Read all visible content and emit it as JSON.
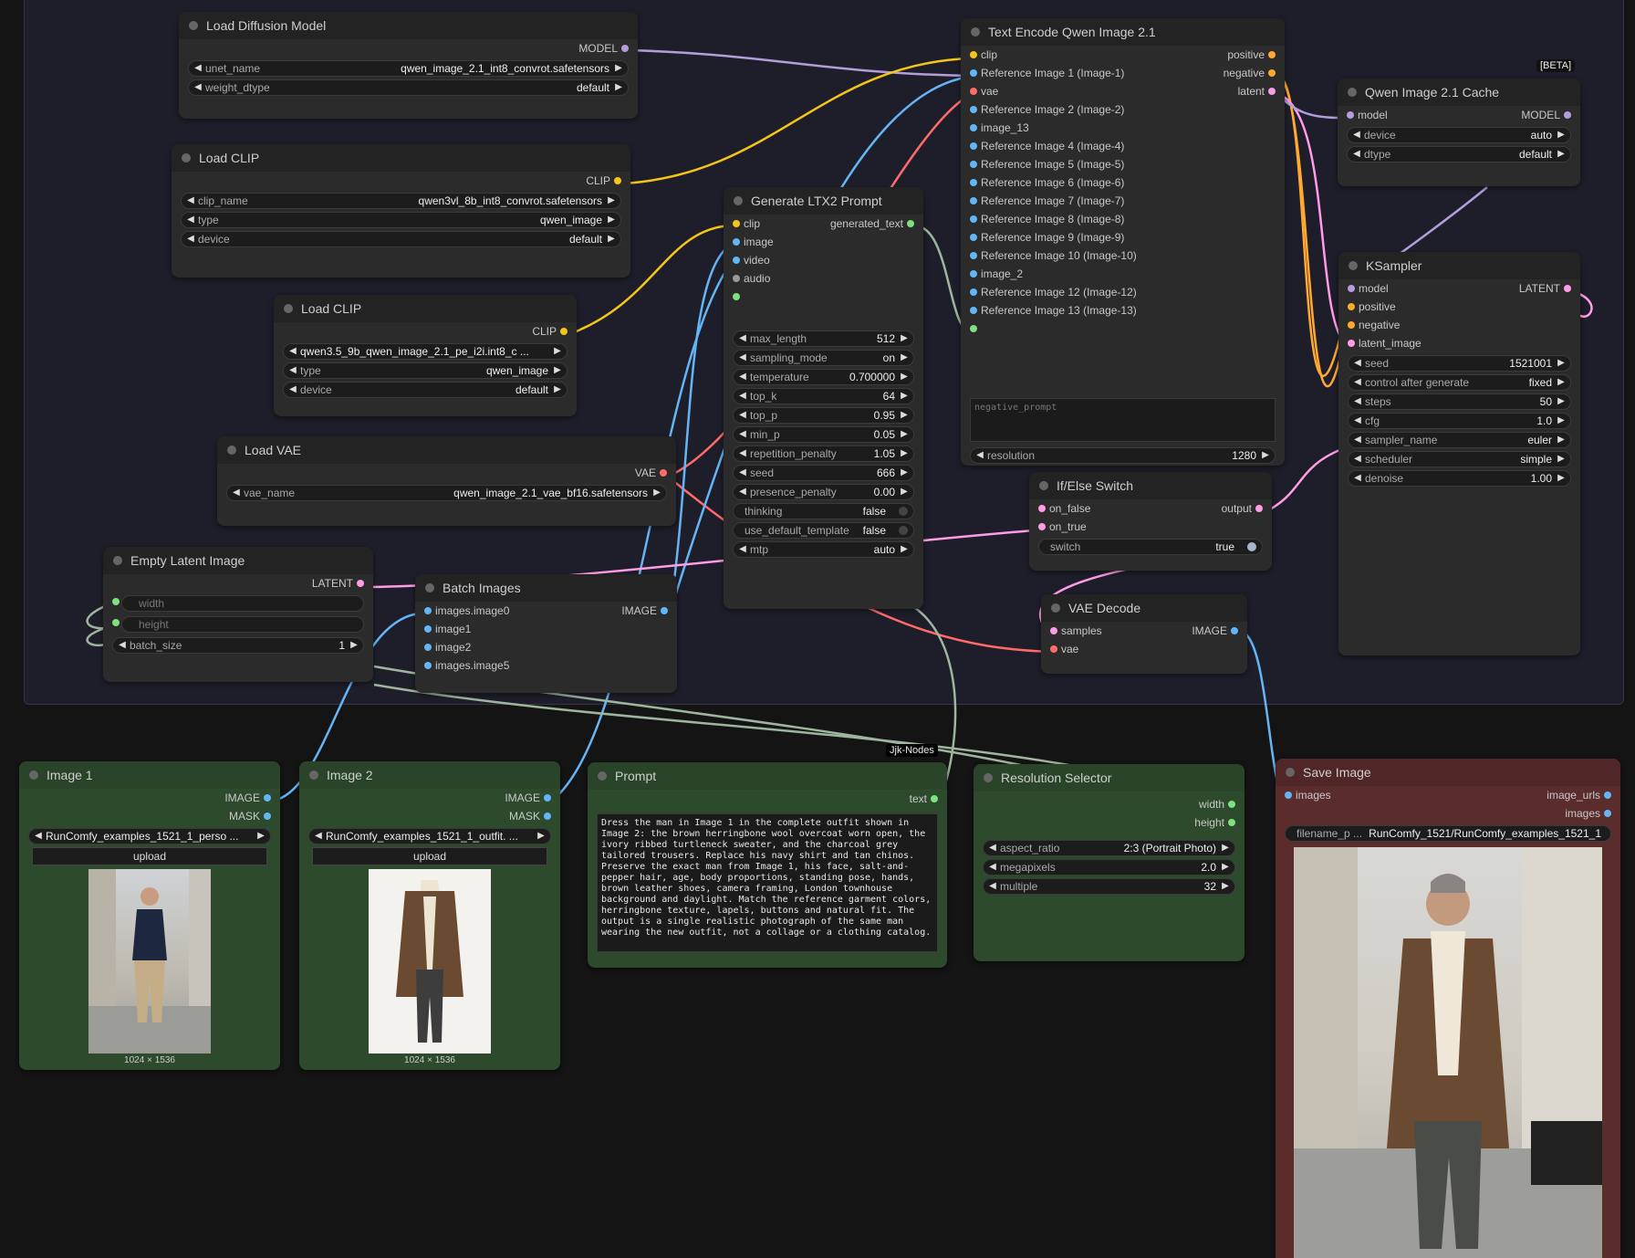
{
  "nodes": {
    "load_diffusion": {
      "title": "Load Diffusion Model",
      "out": "MODEL",
      "unet_label": "unet_name",
      "unet_val": "qwen_image_2.1_int8_convrot.safetensors",
      "dtype_label": "weight_dtype",
      "dtype_val": "default"
    },
    "load_clip1": {
      "title": "Load CLIP",
      "out": "CLIP",
      "name_label": "clip_name",
      "name_val": "qwen3vl_8b_int8_convrot.safetensors",
      "type_label": "type",
      "type_val": "qwen_image",
      "device_label": "device",
      "device_val": "default"
    },
    "load_clip2": {
      "title": "Load CLIP",
      "out": "CLIP",
      "name_val": "qwen3.5_9b_qwen_image_2.1_pe_i2i.int8_c ...",
      "type_label": "type",
      "type_val": "qwen_image",
      "device_label": "device",
      "device_val": "default"
    },
    "load_vae": {
      "title": "Load VAE",
      "out": "VAE",
      "name_label": "vae_name",
      "name_val": "qwen_image_2.1_vae_bf16.safetensors"
    },
    "empty_latent": {
      "title": "Empty Latent Image",
      "out": "LATENT",
      "width": "width",
      "height": "height",
      "batch_label": "batch_size",
      "batch_val": "1"
    },
    "batch_images": {
      "title": "Batch Images",
      "out": "IMAGE",
      "inputs": [
        "images.image0",
        "image1",
        "image2",
        "images.image5"
      ]
    },
    "gen_prompt": {
      "title": "Generate LTX2 Prompt",
      "inputs": [
        "clip",
        "image",
        "video",
        "audio"
      ],
      "out": "generated_text",
      "widgets": [
        {
          "label": "max_length",
          "val": "512"
        },
        {
          "label": "sampling_mode",
          "val": "on"
        },
        {
          "label": "temperature",
          "val": "0.700000"
        },
        {
          "label": "top_k",
          "val": "64"
        },
        {
          "label": "top_p",
          "val": "0.95"
        },
        {
          "label": "min_p",
          "val": "0.05"
        },
        {
          "label": "repetition_penalty",
          "val": "1.05"
        },
        {
          "label": "seed",
          "val": "666"
        },
        {
          "label": "presence_penalty",
          "val": "0.00"
        }
      ],
      "toggles": [
        {
          "label": "thinking",
          "val": "false"
        },
        {
          "label": "use_default_template",
          "val": "false"
        }
      ],
      "mtp_label": "mtp",
      "mtp_val": "auto"
    },
    "text_encode": {
      "title": "Text Encode Qwen Image 2.1",
      "inputs": [
        "clip",
        "Reference Image 1 (Image-1)",
        "vae",
        "Reference Image 2 (Image-2)",
        "image_13",
        "Reference Image 4 (Image-4)",
        "Reference Image 5 (Image-5)",
        "Reference Image 6 (Image-6)",
        "Reference Image 7 (Image-7)",
        "Reference Image 8 (Image-8)",
        "Reference Image 9 (Image-9)",
        "Reference Image 10 (Image-10)",
        "image_2",
        "Reference Image 12 (Image-12)",
        "Reference Image 13 (Image-13)"
      ],
      "outputs": [
        "positive",
        "negative",
        "latent"
      ],
      "neg_placeholder": "negative_prompt",
      "res_label": "resolution",
      "res_val": "1280"
    },
    "cache": {
      "badge": "[BETA]",
      "title": "Qwen Image 2.1 Cache",
      "in": "model",
      "out": "MODEL",
      "device_label": "device",
      "device_val": "auto",
      "dtype_label": "dtype",
      "dtype_val": "default"
    },
    "ksampler": {
      "title": "KSampler",
      "inputs": [
        "model",
        "positive",
        "negative",
        "latent_image"
      ],
      "out": "LATENT",
      "widgets": [
        {
          "label": "seed",
          "val": "1521001"
        },
        {
          "label": "control after generate",
          "val": "fixed"
        },
        {
          "label": "steps",
          "val": "50"
        },
        {
          "label": "cfg",
          "val": "1.0"
        },
        {
          "label": "sampler_name",
          "val": "euler"
        },
        {
          "label": "scheduler",
          "val": "simple"
        },
        {
          "label": "denoise",
          "val": "1.00"
        }
      ]
    },
    "ifelse": {
      "title": "If/Else Switch",
      "in1": "on_false",
      "in2": "on_true",
      "out": "output",
      "switch_label": "switch",
      "switch_val": "true"
    },
    "vae_decode": {
      "title": "VAE Decode",
      "in1": "samples",
      "in2": "vae",
      "out": "IMAGE"
    },
    "image1": {
      "title": "Image 1",
      "out1": "IMAGE",
      "out2": "MASK",
      "file": "RunComfy_examples_1521_1_perso ...",
      "upload": "upload",
      "dims": "1024 × 1536"
    },
    "image2": {
      "title": "Image 2",
      "out1": "IMAGE",
      "out2": "MASK",
      "file": "RunComfy_examples_1521_1_outfit. ...",
      "upload": "upload",
      "dims": "1024 × 1536"
    },
    "prompt": {
      "title": "Prompt",
      "out": "text",
      "text": "Dress the man in Image 1 in the complete outfit shown in Image 2: the brown herringbone wool overcoat worn open, the ivory ribbed turtleneck sweater, and the charcoal grey tailored trousers. Replace his navy shirt and tan chinos. Preserve the exact man from Image 1, his face, salt-and-pepper hair, age, body proportions, standing pose, hands, brown leather shoes, camera framing, London townhouse background and daylight. Match the reference garment colors, herringbone texture, lapels, buttons and natural fit. The output is a single realistic photograph of the same man wearing the new outfit, not a collage or a clothing catalog."
    },
    "jjk": {
      "badge": "Jjk-Nodes"
    },
    "res_selector": {
      "title": "Resolution Selector",
      "out1": "width",
      "out2": "height",
      "widgets": [
        {
          "label": "aspect_ratio",
          "val": "2:3 (Portrait Photo)"
        },
        {
          "label": "megapixels",
          "val": "2.0"
        },
        {
          "label": "multiple",
          "val": "32"
        }
      ]
    },
    "save_image": {
      "title": "Save Image",
      "in": "images",
      "out1": "image_urls",
      "out2": "images",
      "prefix_label": "filename_p ...",
      "prefix_val": "RunComfy_1521/RunComfy_examples_1521_1"
    }
  },
  "colors": {
    "model": "#b39ddb",
    "clip": "#f5c518",
    "vae": "#ff6b6b",
    "image": "#64b5f6",
    "latent": "#ff9ce6",
    "string": "#7ee07e",
    "conditioning": "#ffa931"
  }
}
